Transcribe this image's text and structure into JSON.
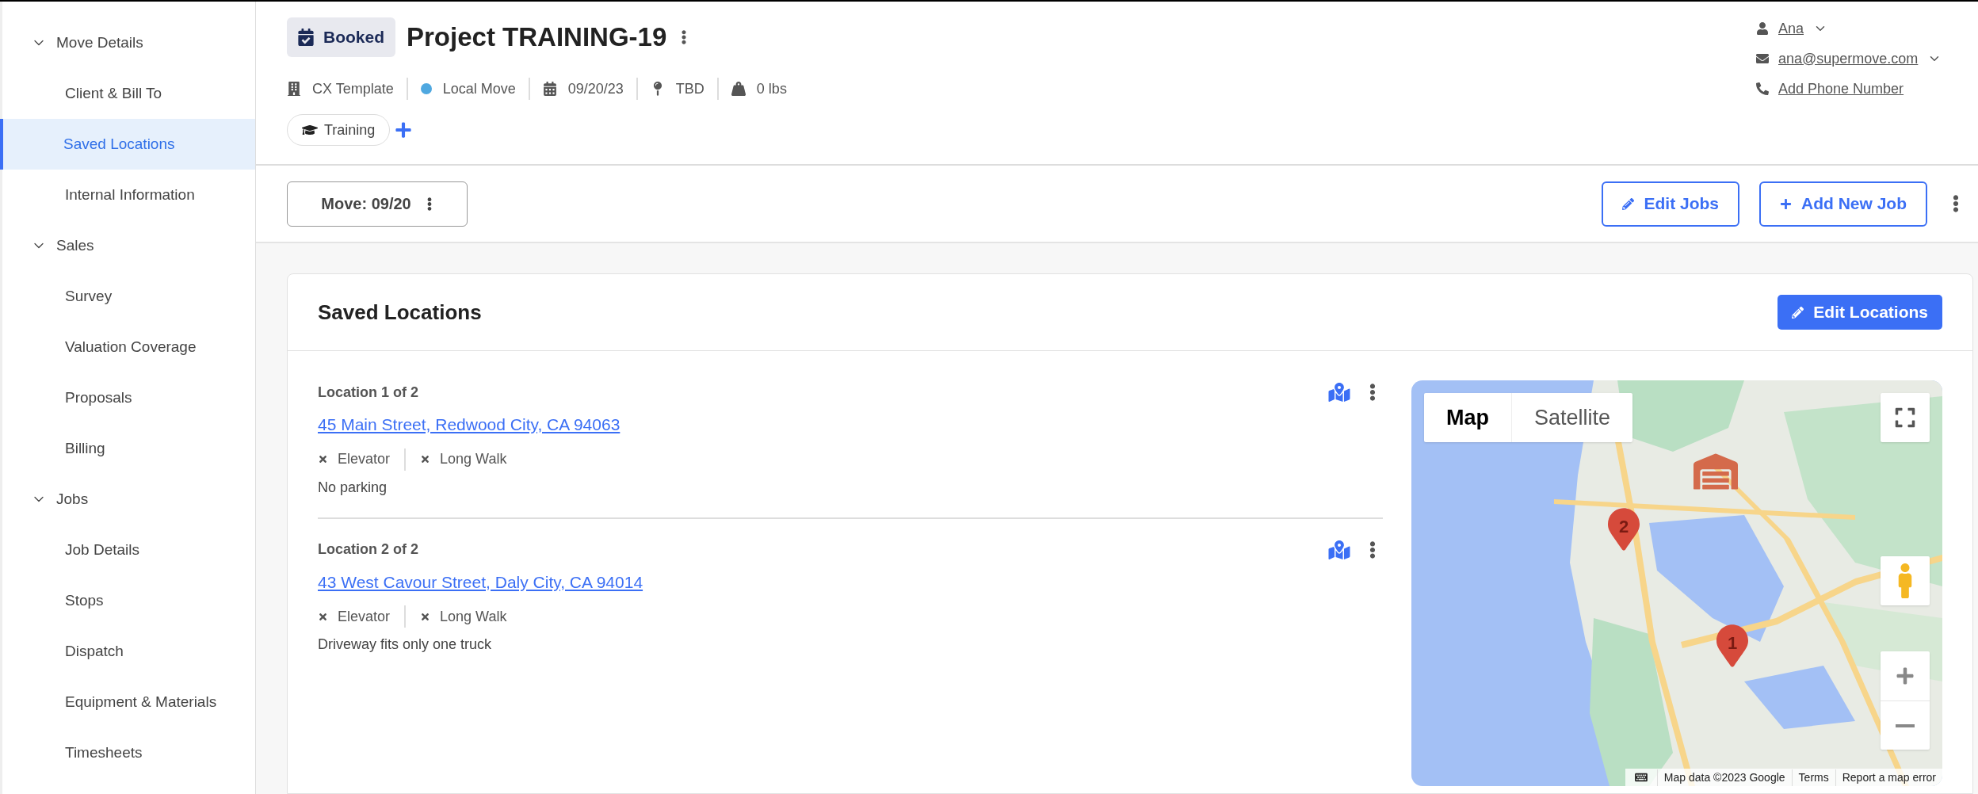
{
  "sidebar": {
    "groups": [
      {
        "label": "Move Details",
        "expanded": true,
        "children": [
          {
            "label": "Client & Bill To",
            "selected": false
          },
          {
            "label": "Saved Locations",
            "selected": true
          },
          {
            "label": "Internal Information",
            "selected": false
          }
        ]
      },
      {
        "label": "Sales",
        "expanded": true,
        "children": [
          {
            "label": "Survey",
            "selected": false
          },
          {
            "label": "Valuation Coverage",
            "selected": false
          },
          {
            "label": "Proposals",
            "selected": false
          },
          {
            "label": "Billing",
            "selected": false
          }
        ]
      },
      {
        "label": "Jobs",
        "expanded": true,
        "children": [
          {
            "label": "Job Details",
            "selected": false
          },
          {
            "label": "Stops",
            "selected": false
          },
          {
            "label": "Dispatch",
            "selected": false
          },
          {
            "label": "Equipment & Materials",
            "selected": false
          },
          {
            "label": "Timesheets",
            "selected": false
          }
        ]
      }
    ]
  },
  "header": {
    "status": "Booked",
    "title": "Project TRAINING-19",
    "meta": [
      {
        "kind": "building",
        "text": "CX Template"
      },
      {
        "kind": "dot",
        "color": "#4fa8e0",
        "text": "Local Move"
      },
      {
        "kind": "calendar",
        "text": "09/20/23"
      },
      {
        "kind": "pin",
        "text": "TBD"
      },
      {
        "kind": "weight",
        "text": "0 lbs"
      }
    ],
    "tags": [
      {
        "label": "Training"
      }
    ]
  },
  "contact": {
    "name": "Ana",
    "email": "ana@supermove.com",
    "phone": "Add Phone Number"
  },
  "toolbar": {
    "move": "Move: 09/20",
    "buttons": [
      {
        "kind": "edit",
        "label": "Edit Jobs"
      },
      {
        "kind": "add",
        "label": "Add New Job"
      }
    ]
  },
  "card": {
    "title": "Saved Locations",
    "button": "Edit Locations",
    "locations": [
      {
        "heading": "Location 1 of 2",
        "address": "45 Main Street, Redwood City, CA 94063",
        "features": [
          {
            "label": "Elevator",
            "available": false
          },
          {
            "label": "Long Walk",
            "available": false
          }
        ],
        "note": "No parking"
      },
      {
        "heading": "Location 2 of 2",
        "address": "43 West Cavour Street, Daly City, CA 94014",
        "features": [
          {
            "label": "Elevator",
            "available": false
          },
          {
            "label": "Long Walk",
            "available": false
          }
        ],
        "note": "Driveway fits only one truck"
      }
    ],
    "map": {
      "tabs": [
        {
          "label": "Map",
          "selected": true
        },
        {
          "label": "Satellite",
          "selected": false
        }
      ],
      "markers": [
        {
          "label": "2"
        },
        {
          "label": "1"
        }
      ],
      "attribution": [
        "Map data ©2023 Google",
        "Terms",
        "Report a map error"
      ]
    }
  }
}
